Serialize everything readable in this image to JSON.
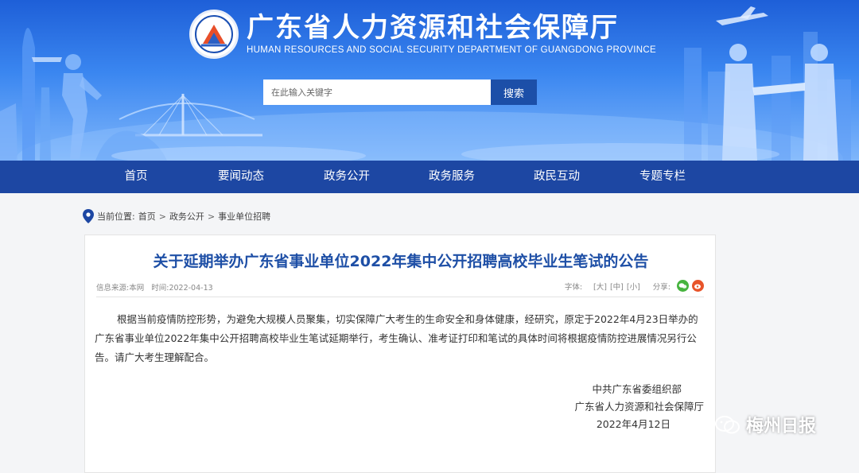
{
  "site": {
    "title_cn": "广东省人力资源和社会保障厅",
    "title_en": "HUMAN RESOURCES AND SOCIAL SECURITY DEPARTMENT OF GUANGDONG PROVINCE"
  },
  "search": {
    "placeholder": "在此输入关键字",
    "button_label": "搜索"
  },
  "nav": {
    "items": [
      "首页",
      "要闻动态",
      "政务公开",
      "政务服务",
      "政民互动",
      "专题专栏"
    ]
  },
  "breadcrumb": {
    "prefix": "当前位置:",
    "items": [
      "首页",
      "政务公开",
      "事业单位招聘"
    ],
    "separator": ">"
  },
  "article": {
    "title": "关于延期举办广东省事业单位2022年集中公开招聘高校毕业生笔试的公告",
    "source_label": "信息来源:",
    "source": "本网",
    "time_label": "时间:",
    "time": "2022-04-13",
    "font_label": "字体:",
    "font_sizes": [
      "[大]",
      "[中]",
      "[小]"
    ],
    "share_label": "分享:",
    "body": "根据当前疫情防控形势，为避免大规模人员聚集，切实保障广大考生的生命安全和身体健康，经研究，原定于2022年4月23日举办的广东省事业单位2022年集中公开招聘高校毕业生笔试延期举行，考生确认、准考证打印和笔试的具体时间将根据疫情防控进展情况另行公告。请广大考生理解配合。",
    "signatures": [
      "中共广东省委组织部",
      "广东省人力资源和社会保障厅"
    ],
    "date": "2022年4月12日"
  },
  "watermark": {
    "text": "梅州日报"
  },
  "colors": {
    "header_blue": "#2d6fe3",
    "nav_blue": "#1d47a3",
    "title_blue": "#1e4fa6",
    "search_button": "#1c4fa8"
  }
}
